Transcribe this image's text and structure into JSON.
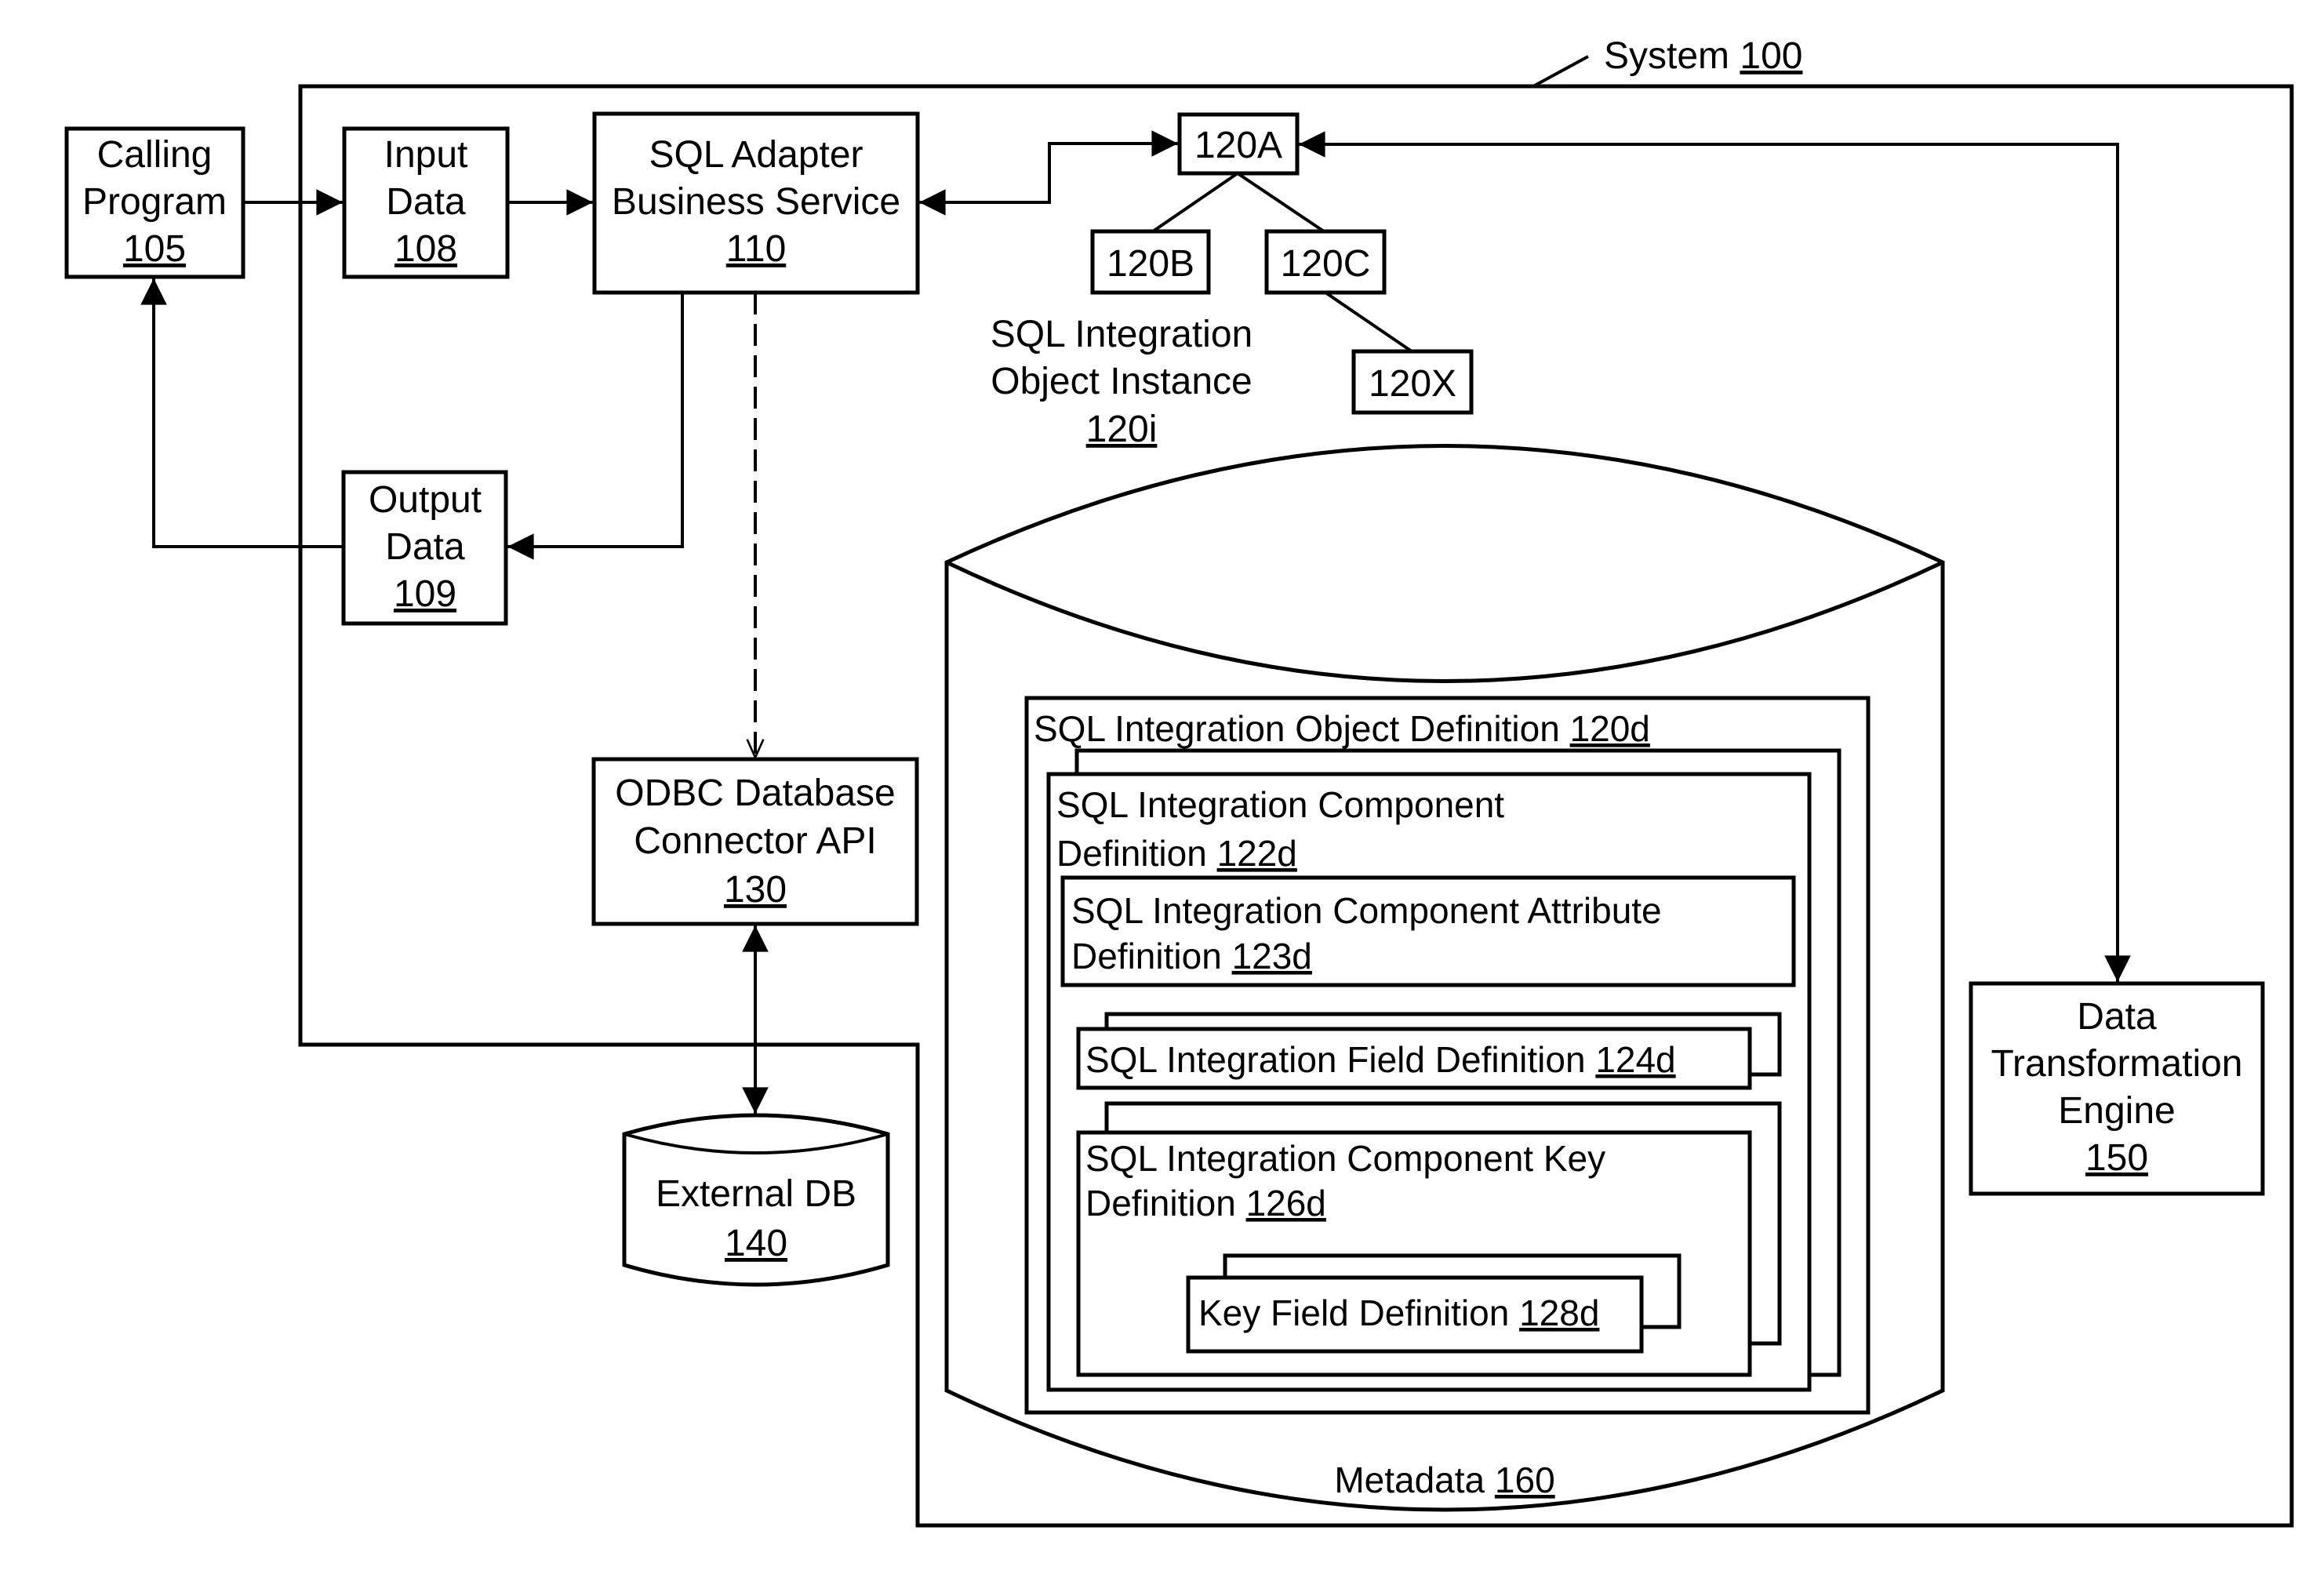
{
  "figure": {
    "system_label": {
      "text": "System",
      "ref": "100"
    },
    "calling_program": {
      "lines": [
        "Calling",
        "Program"
      ],
      "ref": "105"
    },
    "input_data": {
      "lines": [
        "Input",
        "Data"
      ],
      "ref": "108"
    },
    "sql_adapter": {
      "lines": [
        "SQL Adapter",
        "Business Service"
      ],
      "ref": "110"
    },
    "output_data": {
      "lines": [
        "Output",
        "Data"
      ],
      "ref": "109"
    },
    "odbc_connector": {
      "lines": [
        "ODBC Database",
        "Connector API"
      ],
      "ref": "130"
    },
    "external_db": {
      "lines": [
        "External DB"
      ],
      "ref": "140"
    },
    "instance_nodes": {
      "a": "120A",
      "b": "120B",
      "c": "120C",
      "x": "120X"
    },
    "instance_label": {
      "lines": [
        "SQL Integration",
        "Object Instance"
      ],
      "ref": "120i"
    },
    "metadata": {
      "label": {
        "text": "Metadata",
        "ref": "160"
      },
      "object_definition": {
        "text": "SQL Integration Object Definition",
        "ref": "120d"
      },
      "component_definition": {
        "lines": [
          "SQL Integration Component",
          "Definition"
        ],
        "ref": "122d"
      },
      "component_attribute_definition": {
        "lines": [
          "SQL Integration Component Attribute",
          "Definition"
        ],
        "ref": "123d"
      },
      "field_definition": {
        "text": "SQL Integration Field Definition",
        "ref": "124d"
      },
      "component_key_definition": {
        "lines": [
          "SQL Integration Component Key",
          "Definition"
        ],
        "ref": "126d"
      },
      "key_field_definition": {
        "text": "Key Field Definition",
        "ref": "128d"
      }
    },
    "data_transformation_engine": {
      "lines": [
        "Data",
        "Transformation",
        "Engine"
      ],
      "ref": "150"
    }
  }
}
